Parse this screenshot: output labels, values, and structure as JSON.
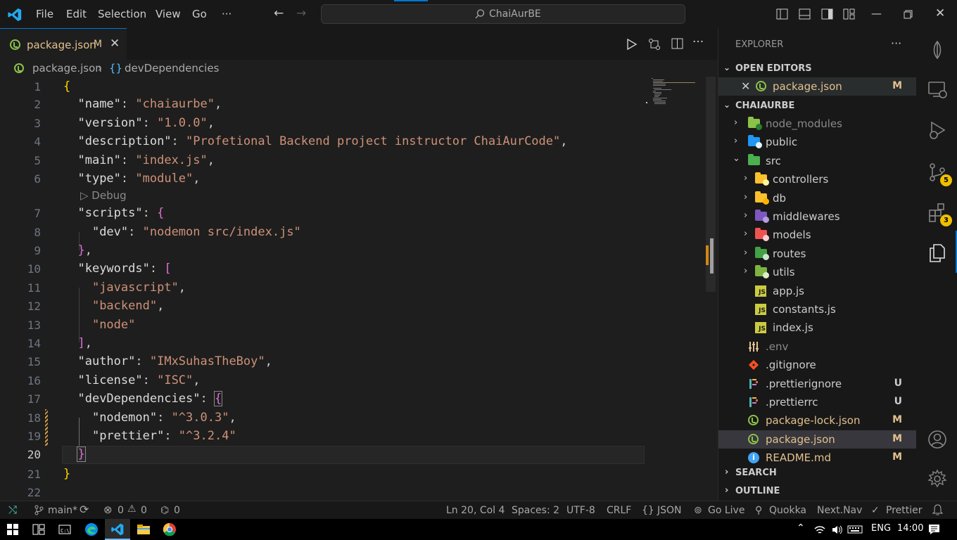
{
  "titlebar": {
    "menus": [
      "File",
      "Edit",
      "Selection",
      "View",
      "Go"
    ],
    "more": "···",
    "search_text": "ChaiAurBE"
  },
  "tab": {
    "filename": "package.json",
    "modified": "M",
    "close": "✕"
  },
  "breadcrumb": {
    "file": "package.json",
    "sep": "›",
    "symbol_icon": "{}",
    "symbol": "devDependencies"
  },
  "codelens": "▷ Debug",
  "explorer": {
    "title": "EXPLORER",
    "more": "···",
    "open_editors": "OPEN EDITORS",
    "open_file": "package.json",
    "open_file_status": "M",
    "project": "CHAIAURBE",
    "search": "SEARCH",
    "outline": "OUTLINE",
    "items": [
      {
        "label": "node_modules",
        "status": ""
      },
      {
        "label": "public",
        "status": ""
      },
      {
        "label": "src",
        "status": ""
      },
      {
        "label": "controllers",
        "status": ""
      },
      {
        "label": "db",
        "status": ""
      },
      {
        "label": "middlewares",
        "status": ""
      },
      {
        "label": "models",
        "status": ""
      },
      {
        "label": "routes",
        "status": ""
      },
      {
        "label": "utils",
        "status": ""
      },
      {
        "label": "app.js",
        "status": ""
      },
      {
        "label": "constants.js",
        "status": ""
      },
      {
        "label": "index.js",
        "status": ""
      },
      {
        "label": ".env",
        "status": ""
      },
      {
        "label": ".gitignore",
        "status": ""
      },
      {
        "label": ".prettierignore",
        "status": "U"
      },
      {
        "label": ".prettierrc",
        "status": "U"
      },
      {
        "label": "package-lock.json",
        "status": "M"
      },
      {
        "label": "package.json",
        "status": "M"
      },
      {
        "label": "README.md",
        "status": "M"
      }
    ]
  },
  "activity": {
    "source_control_badge": "5",
    "extensions_badge": "3"
  },
  "statusbar": {
    "branch": "main*",
    "errors": "0",
    "warnings": "0",
    "ports": "0",
    "position": "Ln 20, Col 4",
    "spaces": "Spaces: 2",
    "encoding": "UTF-8",
    "eol": "CRLF",
    "lang_icon": "{}",
    "language": "JSON",
    "golive": "Go Live",
    "quokka": "Quokka",
    "nextnav": "Next.Nav",
    "prettier": "Prettier"
  },
  "taskbar": {
    "lang": "ENG",
    "time": "14:00"
  },
  "code": {
    "line_numbers": [
      "1",
      "2",
      "3",
      "4",
      "5",
      "6",
      "7",
      "8",
      "9",
      "10",
      "11",
      "12",
      "13",
      "14",
      "15",
      "16",
      "17",
      "18",
      "19",
      "20",
      "21",
      "22"
    ],
    "name_key": "\"name\"",
    "name_val": "\"chaiaurbe\"",
    "version_key": "\"version\"",
    "version_val": "\"1.0.0\"",
    "description_key": "\"description\"",
    "description_val": "\"Profetional Backend project instructor ChaiAurCode\"",
    "main_key": "\"main\"",
    "main_val": "\"index.js\"",
    "type_key": "\"type\"",
    "type_val": "\"module\"",
    "scripts_key": "\"scripts\"",
    "dev_key": "\"dev\"",
    "dev_val": "\"nodemon src/index.js\"",
    "keywords_key": "\"keywords\"",
    "kw1": "\"javascript\"",
    "kw2": "\"backend\"",
    "kw3": "\"node\"",
    "author_key": "\"author\"",
    "author_val": "\"IMxSuhasTheBoy\"",
    "license_key": "\"license\"",
    "license_val": "\"ISC\"",
    "devdeps_key": "\"devDependencies\"",
    "nodemon_key": "\"nodemon\"",
    "nodemon_val": "\"^3.0.3\"",
    "prettier_key": "\"prettier\"",
    "prettier_val": "\"^3.2.4\""
  }
}
